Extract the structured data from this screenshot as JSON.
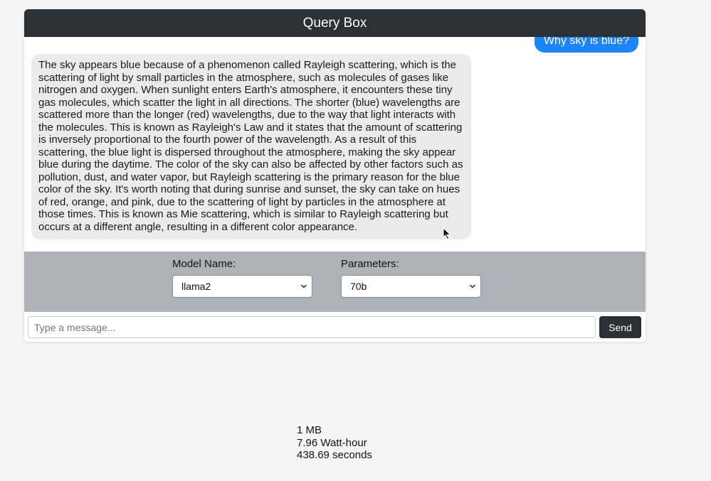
{
  "header": {
    "title": "Query Box"
  },
  "chat": {
    "user_message": "Why sky is blue?",
    "bot_message": "The sky appears blue because of a phenomenon called Rayleigh scattering, which is the scattering of light by small particles in the atmosphere, such as molecules of gases like nitrogen and oxygen. When sunlight enters Earth's atmosphere, it encounters these tiny gas molecules, which scatter the light in all directions. The shorter (blue) wavelengths are scattered more than the longer (red) wavelengths, due to the way that light interacts with the molecules. This is known as Rayleigh's Law and it states that the amount of scattering is inversely proportional to the fourth power of the wavelength. As a result of this scattering, the blue light is dispersed throughout the atmosphere, making the sky appear blue during the daytime. The color of the sky can also be affected by other factors such as pollution, dust, and water vapor, but Rayleigh scattering is the primary reason for the blue color of the sky. It's worth noting that during sunrise and sunset, the sky can take on hues of red, orange, and pink, due to the scattering of light by particles in the atmosphere at those times. This is known as Mie scattering, which is similar to Rayleigh scattering but occurs at a different angle, resulting in a different color appearance."
  },
  "controls": {
    "model": {
      "label": "Model Name:",
      "selected": "llama2"
    },
    "parameters": {
      "label": "Parameters:",
      "selected": "70b"
    }
  },
  "composer": {
    "placeholder": "Type a message...",
    "send_label": "Send"
  },
  "stats": {
    "size": "1 MB",
    "energy": "7.96 Watt-hour",
    "time": "438.69 seconds"
  },
  "colors": {
    "header_bg": "#2b3034",
    "user_bubble": "#1b84f8",
    "bot_bubble": "#ebebeb",
    "controls_bg": "#adb2b9"
  },
  "icons": [
    "chevron-down-icon",
    "mouse-cursor-icon"
  ]
}
